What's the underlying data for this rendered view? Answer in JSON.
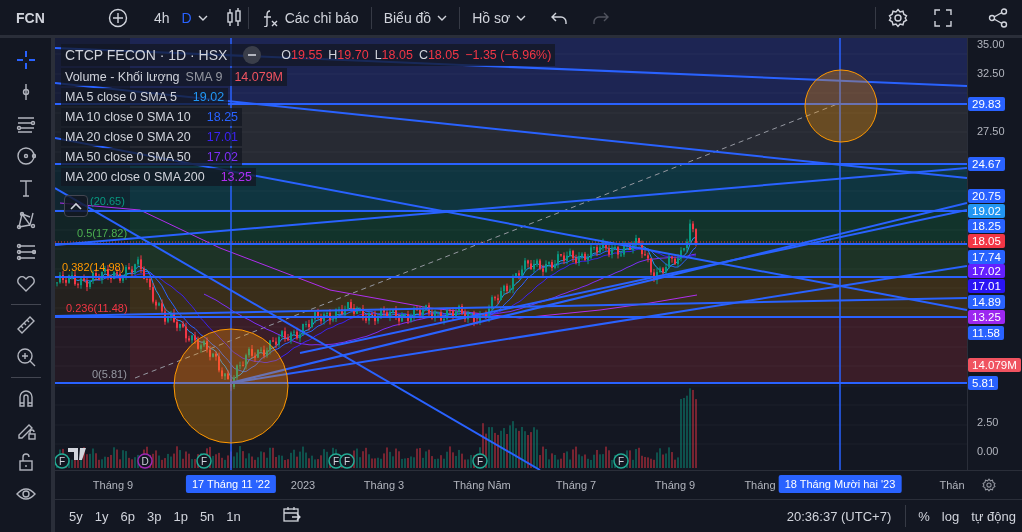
{
  "top_bar": {
    "symbol": "FCN",
    "intervals": [
      {
        "label": "4h",
        "selected": false
      },
      {
        "label": "D",
        "selected": true
      }
    ],
    "indicators_button": "Các chỉ báo",
    "chart_menu": "Biểu đồ",
    "profile_menu": "Hồ sơ"
  },
  "drawing_tools": [
    {
      "kind": "crosshair",
      "selected": true
    },
    {
      "kind": "trendline",
      "selected": false
    },
    {
      "kind": "channel",
      "selected": false
    },
    {
      "kind": "circle",
      "selected": false
    },
    {
      "kind": "text",
      "selected": false
    },
    {
      "kind": "pattern",
      "selected": false
    },
    {
      "kind": "projection",
      "selected": false
    },
    {
      "kind": "heart",
      "selected": false
    },
    {
      "kind": "divider"
    },
    {
      "kind": "ruler",
      "selected": false
    },
    {
      "kind": "zoom",
      "selected": false
    },
    {
      "kind": "divider"
    },
    {
      "kind": "magnet",
      "selected": false
    },
    {
      "kind": "pencil-lock",
      "selected": false
    },
    {
      "kind": "lock",
      "selected": false
    },
    {
      "kind": "eye",
      "selected": false
    }
  ],
  "legend": {
    "title": "CTCP FECON · 1D · HSX",
    "ohlc": [
      {
        "label": "O",
        "value": "19.55"
      },
      {
        "label": "H",
        "value": "19.70"
      },
      {
        "label": "L",
        "value": "18.05"
      },
      {
        "label": "C",
        "value": "18.05"
      }
    ],
    "change": "−1.35 (−6.96%)",
    "volume": {
      "name": "Volume - Khối lượng",
      "params": "SMA 9",
      "value": "14.079M"
    },
    "moving_averages": [
      {
        "name": "MA 5 close 0 SMA 5",
        "value": "19.02",
        "color": "#2196f3"
      },
      {
        "name": "MA 10 close 0 SMA 10",
        "value": "18.25",
        "color": "#2962ff"
      },
      {
        "name": "MA 20 close 0 SMA 20",
        "value": "17.01",
        "color": "#3b22f0"
      },
      {
        "name": "MA 50 close 0 SMA 50",
        "value": "17.02",
        "color": "#7b2ff7"
      },
      {
        "name": "MA 200 close 0 SMA 200",
        "value": "13.25",
        "color": "#b02ef0"
      }
    ]
  },
  "fib_labels": [
    {
      "text": "(20.65)",
      "color": "#089981"
    },
    {
      "text": "0.5(17.82)",
      "color": "#4caf50"
    },
    {
      "text": "0.382(14.98)",
      "color": "#ff9800"
    },
    {
      "text": "0.236(11.48)",
      "color": "#f23645"
    },
    {
      "text": "0(5.81)",
      "color": "#9598a1"
    }
  ],
  "events": [
    {
      "kind": "earnings",
      "text": "F"
    },
    {
      "kind": "dividend",
      "text": "D"
    },
    {
      "kind": "earnings",
      "text": "F"
    },
    {
      "kind": "earnings",
      "text": "F"
    },
    {
      "kind": "earnings",
      "text": "F"
    },
    {
      "kind": "earnings",
      "text": "F"
    },
    {
      "kind": "earnings",
      "text": "F"
    }
  ],
  "price_axis": {
    "ticks": [
      "35.00",
      "32.50",
      "27.50",
      "2.50",
      "0.00"
    ],
    "labels": [
      {
        "text": "29.83",
        "color": "#2962ff"
      },
      {
        "text": "24.67",
        "color": "#2962ff"
      },
      {
        "text": "20.75",
        "color": "#2962ff"
      },
      {
        "text": "19.02",
        "color": "#2196f3"
      },
      {
        "text": "18.25",
        "color": "#2962ff"
      },
      {
        "text": "18.05",
        "color": "#f23645"
      },
      {
        "text": "17.74",
        "color": "#2962ff"
      },
      {
        "text": "17.02",
        "color": "#651fff"
      },
      {
        "text": "17.01",
        "color": "#2a14f5"
      },
      {
        "text": "14.89",
        "color": "#2962ff"
      },
      {
        "text": "13.25",
        "color": "#9c27f0"
      },
      {
        "text": "11.58",
        "color": "#2962ff"
      },
      {
        "text": "14.079M",
        "color": "#f05360"
      },
      {
        "text": "5.81",
        "color": "#2962ff"
      }
    ]
  },
  "time_axis": {
    "labels": [
      "Tháng 9",
      "2023",
      "Tháng 3",
      "Tháng Năm",
      "Tháng 7",
      "Tháng 9",
      "Tháng",
      "Thán"
    ],
    "crosshair_labels": [
      "17 Tháng 11 '22",
      "18 Tháng Mười hai '23"
    ]
  },
  "bottom_bar": {
    "ranges": [
      "5y",
      "1y",
      "6p",
      "3p",
      "1p",
      "5n",
      "1n"
    ],
    "clock": "20:36:37 (UTC+7)",
    "scale_options": [
      "%",
      "log",
      "tự động"
    ]
  }
}
